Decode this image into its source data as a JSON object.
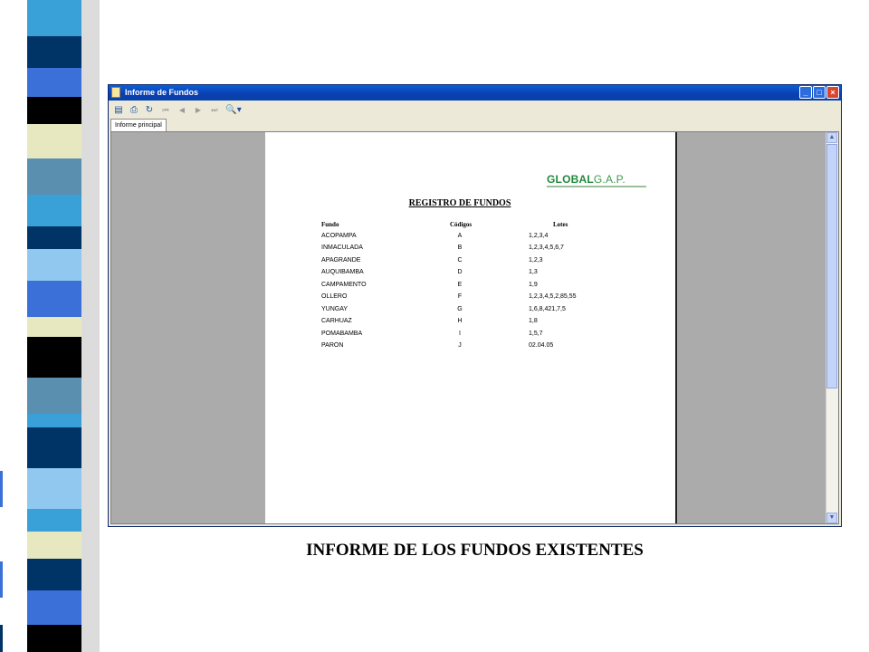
{
  "window": {
    "title": "Informe de Fundos"
  },
  "tabs": [
    {
      "label": "Informe principal"
    }
  ],
  "toolbar": {
    "buttons": [
      "export-icon",
      "print-icon",
      "refresh-icon",
      "first-page-icon",
      "previous-page-icon",
      "next-page-icon",
      "last-page-icon",
      "zoom-icon"
    ]
  },
  "report": {
    "logo": {
      "bold": "GLOBAL",
      "light": "G.A.P."
    },
    "title": "REGISTRO DE FUNDOS",
    "columns": [
      "Fundo",
      "Códigos",
      "Lotes"
    ],
    "rows": [
      [
        "ACOPAMPA",
        "A",
        "1,2,3,4"
      ],
      [
        "INMACULADA",
        "B",
        "1,2,3,4,5,6,7"
      ],
      [
        "APAGRANDE",
        "C",
        "1,2,3"
      ],
      [
        "AUQUIBAMBA",
        "D",
        "1,3"
      ],
      [
        "CAMPAMENTO",
        "E",
        "1,9"
      ],
      [
        "OLLERO",
        "F",
        "1,2,3,4,5,2,85,55"
      ],
      [
        "YUNGAY",
        "G",
        "1,6,8,421,7,5"
      ],
      [
        "CARHUAZ",
        "H",
        "1,8"
      ],
      [
        "POMABAMBA",
        "I",
        "1,5,7"
      ],
      [
        "PARON",
        "J",
        "02.04.05"
      ]
    ]
  },
  "caption": "INFORME DE LOS FUNDOS EXISTENTES",
  "colors": {
    "titlebar": "#0a4fc8",
    "logo": "#1f8a3c",
    "viewer_bg": "#ababab"
  }
}
